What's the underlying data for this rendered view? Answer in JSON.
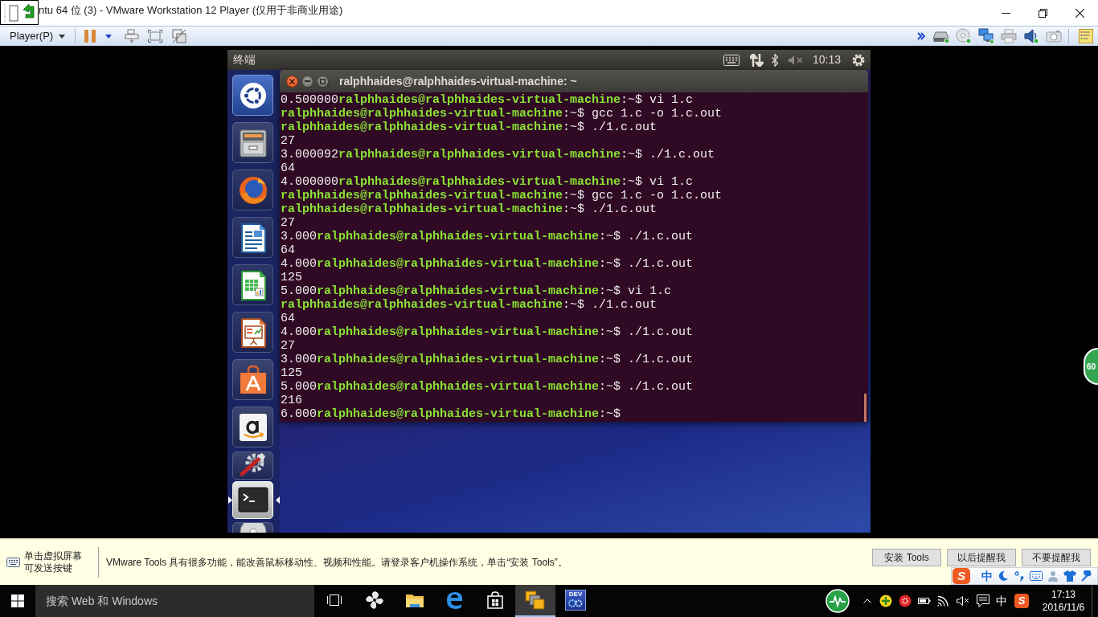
{
  "vm_window": {
    "title": "ntu 64 位 (3) - VMware Workstation 12 Player (仅用于非商业用途)",
    "menu": "Player(P)"
  },
  "guest": {
    "top_panel": {
      "app_name": "终端",
      "time": "10:13"
    },
    "launcher": [
      {
        "kind": "dash",
        "active": false
      },
      {
        "kind": "files",
        "active": false
      },
      {
        "kind": "browser",
        "active": false
      },
      {
        "kind": "writer",
        "active": false
      },
      {
        "kind": "calc",
        "active": false
      },
      {
        "kind": "impress",
        "active": false
      },
      {
        "kind": "store",
        "active": false
      },
      {
        "kind": "amazon",
        "active": false
      },
      {
        "kind": "settings",
        "active": false
      },
      {
        "kind": "terminal",
        "active": true
      },
      {
        "kind": "disc",
        "active": false
      }
    ],
    "terminal": {
      "title": "ralphhaides@ralphhaides-virtual-machine: ~",
      "lines": [
        {
          "output": "0.500000",
          "user_host": "ralphhaides@ralphhaides-virtual-machine",
          "input": ":~$ vi 1.c"
        },
        {
          "user_host": "ralphhaides@ralphhaides-virtual-machine",
          "input": ":~$ gcc 1.c -o 1.c.out"
        },
        {
          "user_host": "ralphhaides@ralphhaides-virtual-machine",
          "input": ":~$ ./1.c.out"
        },
        {
          "output": "27"
        },
        {
          "output": "3.000092",
          "user_host": "ralphhaides@ralphhaides-virtual-machine",
          "input": ":~$ ./1.c.out"
        },
        {
          "output": "64"
        },
        {
          "output": "4.000000",
          "user_host": "ralphhaides@ralphhaides-virtual-machine",
          "input": ":~$ vi 1.c"
        },
        {
          "user_host": "ralphhaides@ralphhaides-virtual-machine",
          "input": ":~$ gcc 1.c -o 1.c.out"
        },
        {
          "user_host": "ralphhaides@ralphhaides-virtual-machine",
          "input": ":~$ ./1.c.out"
        },
        {
          "output": "27"
        },
        {
          "output": "3.000",
          "user_host": "ralphhaides@ralphhaides-virtual-machine",
          "input": ":~$ ./1.c.out"
        },
        {
          "output": "64"
        },
        {
          "output": "4.000",
          "user_host": "ralphhaides@ralphhaides-virtual-machine",
          "input": ":~$ ./1.c.out"
        },
        {
          "output": "125"
        },
        {
          "output": "5.000",
          "user_host": "ralphhaides@ralphhaides-virtual-machine",
          "input": ":~$ vi 1.c"
        },
        {
          "user_host": "ralphhaides@ralphhaides-virtual-machine",
          "input": ":~$ ./1.c.out"
        },
        {
          "output": "64"
        },
        {
          "output": "4.000",
          "user_host": "ralphhaides@ralphhaides-virtual-machine",
          "input": ":~$ ./1.c.out"
        },
        {
          "output": "27"
        },
        {
          "output": "3.000",
          "user_host": "ralphhaides@ralphhaides-virtual-machine",
          "input": ":~$ ./1.c.out"
        },
        {
          "output": "125"
        },
        {
          "output": "5.000",
          "user_host": "ralphhaides@ralphhaides-virtual-machine",
          "input": ":~$ ./1.c.out"
        },
        {
          "output": "216"
        },
        {
          "output": "6.000",
          "user_host": "ralphhaides@ralphhaides-virtual-machine",
          "input": ":~$"
        }
      ]
    }
  },
  "side_badge": "60",
  "notification": {
    "hint": [
      "单击虚拟屏幕",
      "可发送按键"
    ],
    "message": "VMware Tools 具有很多功能，能改善鼠标移动性、视频和性能。请登录客户机操作系统，单击“安装 Tools”。",
    "buttons": [
      "安装 Tools",
      "以后提醒我",
      "不要提醒我"
    ]
  },
  "ime_bar": {
    "logo": "S",
    "mode": "中"
  },
  "taskbar": {
    "search": {
      "placeholder": "搜索 Web 和 Windows"
    },
    "apps": [
      {
        "kind": "task-view",
        "active": false
      },
      {
        "kind": "pinwheel",
        "active": false
      },
      {
        "kind": "explorer",
        "active": false
      },
      {
        "kind": "browser",
        "active": false
      },
      {
        "kind": "store",
        "active": false
      },
      {
        "kind": "vmware",
        "active": true
      },
      {
        "kind": "devcpp",
        "active": false,
        "label": "DEV"
      }
    ],
    "tray": {
      "ime": "中",
      "logo": "S",
      "time": "17:13",
      "date": "2016/11/6"
    }
  }
}
